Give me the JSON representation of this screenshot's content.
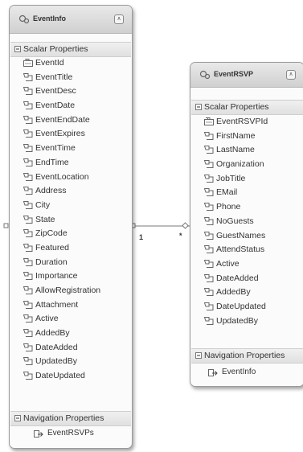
{
  "entities": [
    {
      "title": "EventInfo",
      "scalar_header": "Scalar Properties",
      "key_property": "EventId",
      "properties": [
        "EventTitle",
        "EventDesc",
        "EventDate",
        "EventEndDate",
        "EventExpires",
        "EventTime",
        "EndTime",
        "EventLocation",
        "Address",
        "City",
        "State",
        "ZipCode",
        "Featured",
        "Duration",
        "Importance",
        "AllowRegistration",
        "Attachment",
        "Active",
        "AddedBy",
        "DateAdded",
        "UpdatedBy",
        "DateUpdated"
      ],
      "nav_header": "Navigation Properties",
      "nav_properties": [
        "EventRSVPs"
      ]
    },
    {
      "title": "EventRSVP",
      "scalar_header": "Scalar Properties",
      "key_property": "EventRSVPId",
      "properties": [
        "FirstName",
        "LastName",
        "Organization",
        "JobTitle",
        "EMail",
        "Phone",
        "NoGuests",
        "GuestNames",
        "AttendStatus",
        "Active",
        "DateAdded",
        "AddedBy",
        "DateUpdated",
        "UpdatedBy"
      ],
      "nav_header": "Navigation Properties",
      "nav_properties": [
        "EventInfo"
      ]
    }
  ],
  "association": {
    "end1_multiplicity": "1",
    "end2_multiplicity": "*"
  },
  "icons": {
    "entity": "entity-icon",
    "key": "key-property-icon",
    "property": "property-icon",
    "navigation": "navigation-property-icon",
    "collapse": "collapse-icon",
    "section_toggle": "section-collapse-icon"
  },
  "colors": {
    "header_bg": "#d8d8d8",
    "border": "#9a9a9a",
    "text": "#333333"
  }
}
